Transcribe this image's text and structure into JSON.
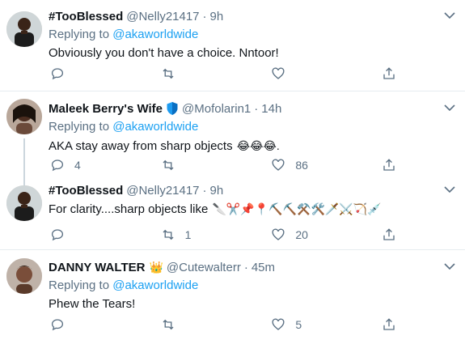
{
  "tweets": [
    {
      "name": "#TooBlessed",
      "handle": "@Nelly21417",
      "time": "9h",
      "replying_prefix": "Replying to ",
      "replying_to": "@akaworldwide",
      "text": "Obviously you don't have a choice. Nntoor!",
      "reply_count": "",
      "retweet_count": "",
      "like_count": ""
    },
    {
      "name": "Maleek Berry's Wife",
      "handle": "@Mofolarin1",
      "time": "14h",
      "replying_prefix": "Replying to ",
      "replying_to": "@akaworldwide",
      "text": "AKA stay away from sharp objects ",
      "emoji": "😂😂😂.",
      "reply_count": "4",
      "retweet_count": "",
      "like_count": "86"
    },
    {
      "name": "#TooBlessed",
      "handle": "@Nelly21417",
      "time": "9h",
      "text": "For clarity....sharp objects like ",
      "emoji": "🔪✂️📌📍⛏️⛏️⚒️🛠️🗡️⚔️🏹💉",
      "reply_count": "",
      "retweet_count": "1",
      "like_count": "20"
    },
    {
      "name": "DANNY WALTER",
      "handle": "@Cutewalterr",
      "time": "45m",
      "name_emoji": "👑",
      "replying_prefix": "Replying to ",
      "replying_to": "@akaworldwide",
      "text": "Phew the Tears!",
      "reply_count": "",
      "retweet_count": "",
      "like_count": "5"
    }
  ],
  "separator": "·",
  "colors": {
    "link": "#1da1f2",
    "muted": "#5b7083",
    "divider": "#e6ecf0",
    "verified": "#1d9bf0"
  },
  "icons": [
    "reply-icon",
    "retweet-icon",
    "like-icon",
    "share-icon",
    "caret-down-icon",
    "verified-shield-icon"
  ]
}
